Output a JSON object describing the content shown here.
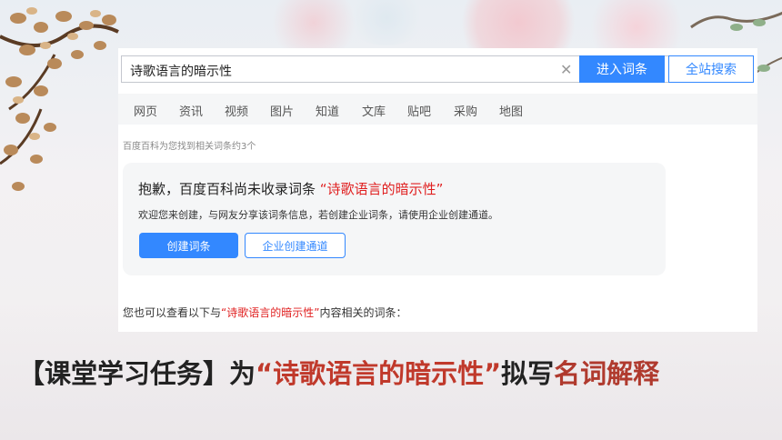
{
  "colors": {
    "primary_blue": "#3388ff",
    "accent_red": "#e02020",
    "caption_accent": "#c0392b"
  },
  "search": {
    "query": "诗歌语言的暗示性",
    "clear_icon": "close-icon",
    "enter_button": "进入词条",
    "all_search_button": "全站搜索"
  },
  "nav": {
    "items": [
      "网页",
      "资讯",
      "视频",
      "图片",
      "知道",
      "文库",
      "贴吧",
      "采购",
      "地图"
    ]
  },
  "result_count": "百度百科为您找到相关词条约3个",
  "card": {
    "title_prefix": "抱歉，百度百科尚未收录词条",
    "title_term": "“诗歌语言的暗示性”",
    "description": "欢迎您来创建，与网友分享该词条信息，若创建企业词条，请使用企业创建通道。",
    "create_button": "创建词条",
    "corp_button": "企业创建通道"
  },
  "also_see": {
    "prefix": "您也可以查看以下与",
    "term": "“诗歌语言的暗示性”",
    "suffix": "内容相关的词条："
  },
  "caption": {
    "part1": "【课堂学习任务】为",
    "part2": "“诗歌语言的暗示性”",
    "part3": "拟写",
    "part4": "名词解释"
  }
}
